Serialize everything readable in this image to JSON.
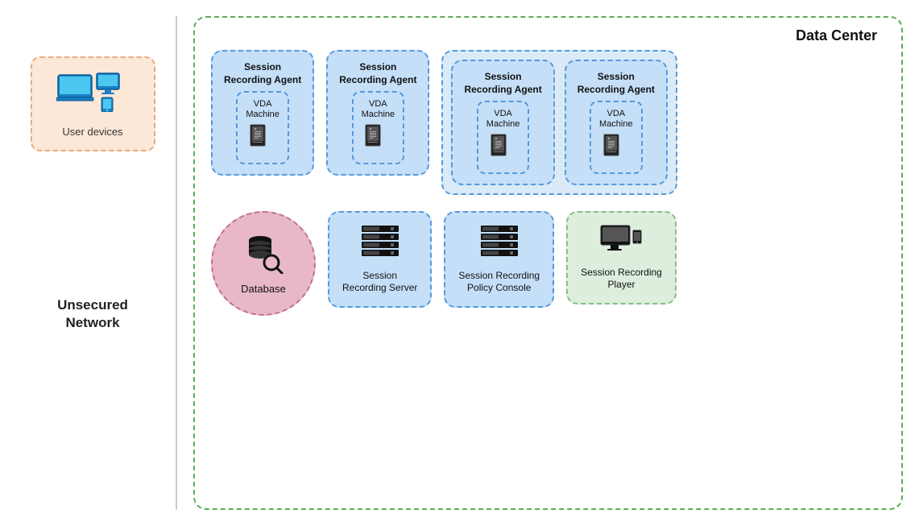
{
  "left": {
    "unsecured_network": "Unsecured\nNetwork",
    "user_devices_label": "User devices"
  },
  "right": {
    "data_center_title": "Data Center",
    "agents": [
      {
        "title": "Session\nRecording Agent",
        "vda": "VDA\nMachine"
      },
      {
        "title": "Session\nRecording Agent",
        "vda": "VDA\nMachine"
      },
      {
        "title": "Session\nRecording Agent",
        "vda": "VDA\nMachine"
      },
      {
        "title": "Session\nRecording Agent",
        "vda": "VDA\nMachine"
      }
    ],
    "database_label": "Database",
    "session_recording_server": "Session\nRecording Server",
    "session_recording_policy": "Session Recording\nPolicy Console",
    "session_recording_player": "Session Recording\nPlayer"
  }
}
